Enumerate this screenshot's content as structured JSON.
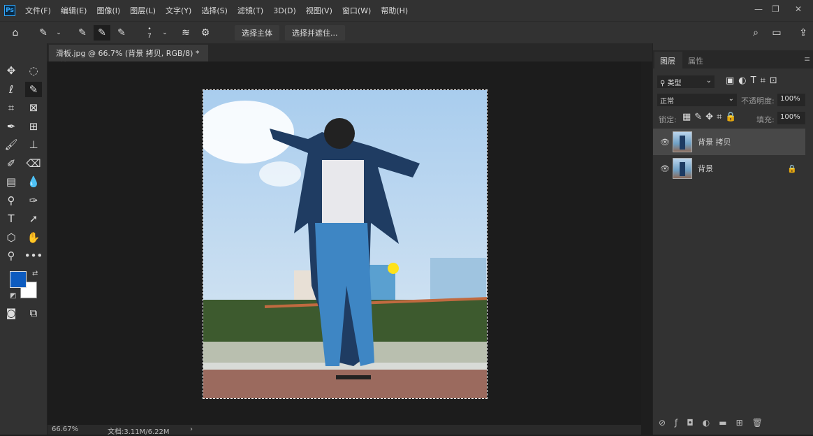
{
  "app": {
    "logo": "Ps"
  },
  "menu": [
    "文件(F)",
    "编辑(E)",
    "图像(I)",
    "图层(L)",
    "文字(Y)",
    "选择(S)",
    "滤镜(T)",
    "3D(D)",
    "视图(V)",
    "窗口(W)",
    "帮助(H)"
  ],
  "options": {
    "brush_size": "7",
    "select_subject": "选择主体",
    "select_mask": "选择并遮住..."
  },
  "document_tab": {
    "title": "滑板.jpg @ 66.7% (背景 拷贝, RGB/8) *",
    "close": "×"
  },
  "colors": {
    "foreground": "#0d5bbf",
    "background": "#ffffff"
  },
  "panel": {
    "tabs": [
      "图层",
      "属性"
    ],
    "filter": "类型",
    "blend_mode": "正常",
    "opacity_label": "不透明度:",
    "opacity": "100%",
    "lock_label": "锁定:",
    "fill_label": "填充:",
    "fill": "100%",
    "layers": [
      {
        "name": "背景 拷贝",
        "selected": true
      },
      {
        "name": "背景",
        "locked": true
      }
    ]
  },
  "status": {
    "zoom": "66.67%",
    "doc": "文档:3.11M/6.22M",
    "arrow": "›"
  }
}
